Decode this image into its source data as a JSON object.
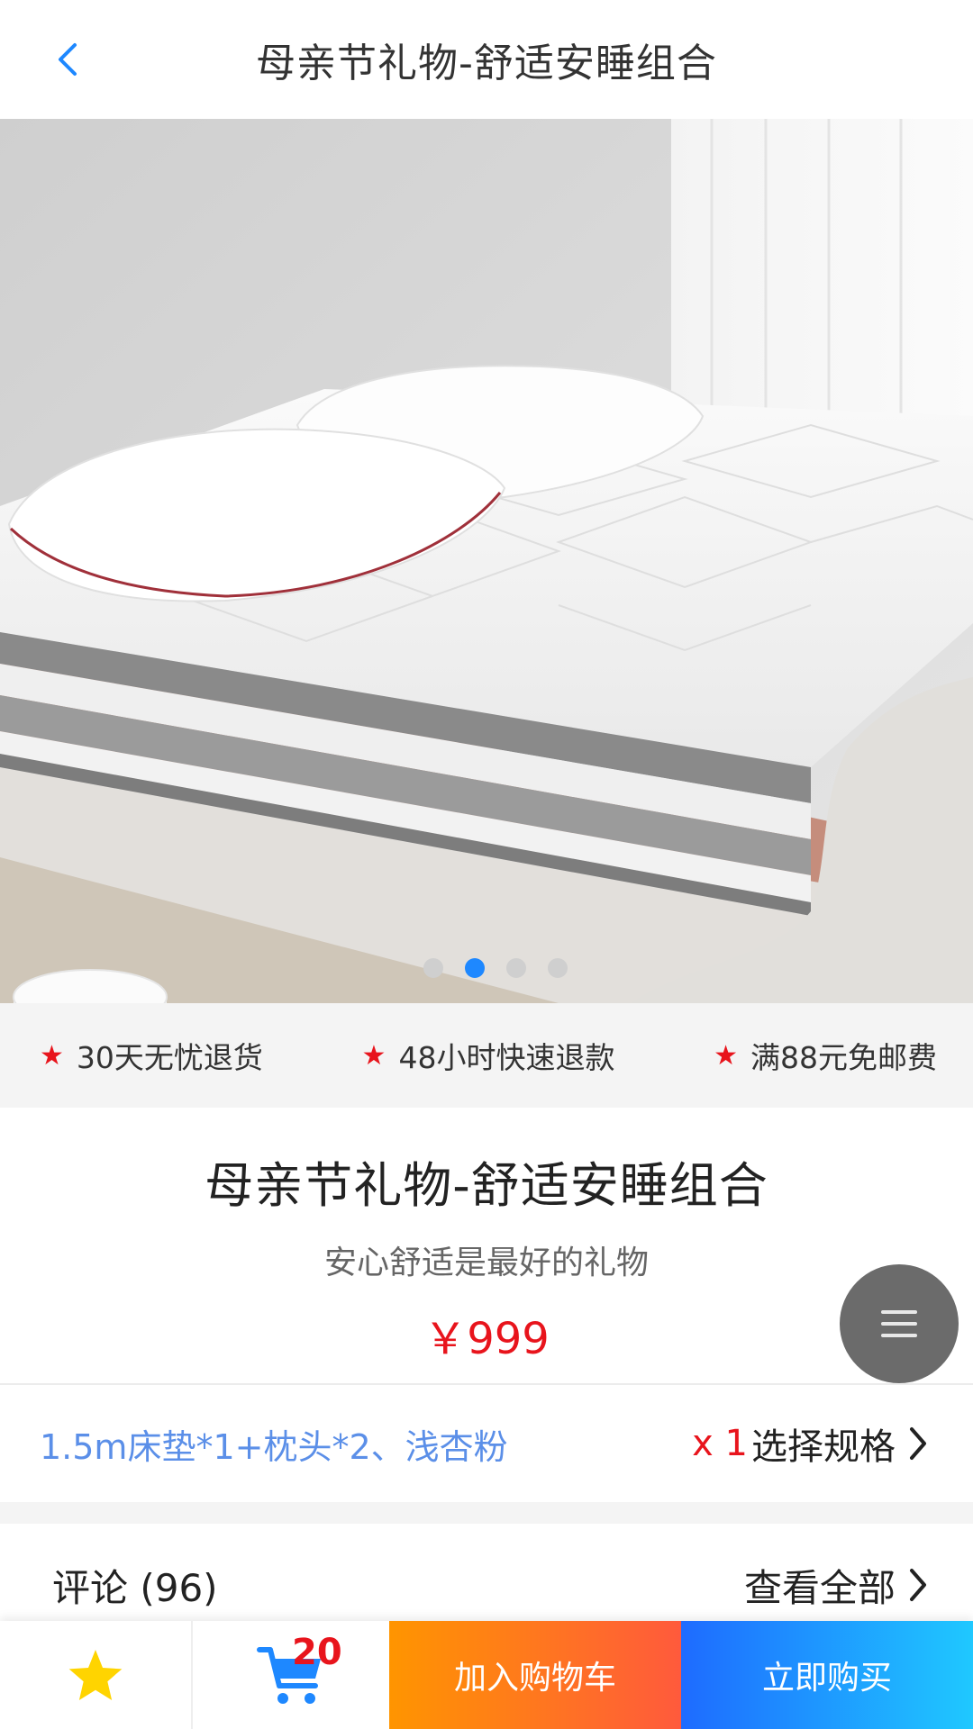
{
  "header": {
    "title": "母亲节礼物-舒适安睡组合",
    "back_icon": "chevron-left-icon"
  },
  "gallery": {
    "image_count": 4,
    "active_index": 1
  },
  "services": [
    {
      "label": "30天无忧退货"
    },
    {
      "label": "48小时快速退款"
    },
    {
      "label": "满88元免邮费"
    }
  ],
  "product": {
    "name": "母亲节礼物-舒适安睡组合",
    "subtitle": "安心舒适是最好的礼物",
    "price": "￥999"
  },
  "spec": {
    "value": "1.5m床垫*1+枕头*2、浅杏粉",
    "qty": "x 1",
    "action": "选择规格"
  },
  "comments": {
    "title": "评论 (96)",
    "view_all": "查看全部"
  },
  "bottom_bar": {
    "cart_count": "20",
    "add_to_cart": "加入购物车",
    "buy_now": "立即购买"
  },
  "colors": {
    "accent_blue": "#1e88ff",
    "price_red": "#e8141c",
    "star_yellow": "#ffd400"
  }
}
